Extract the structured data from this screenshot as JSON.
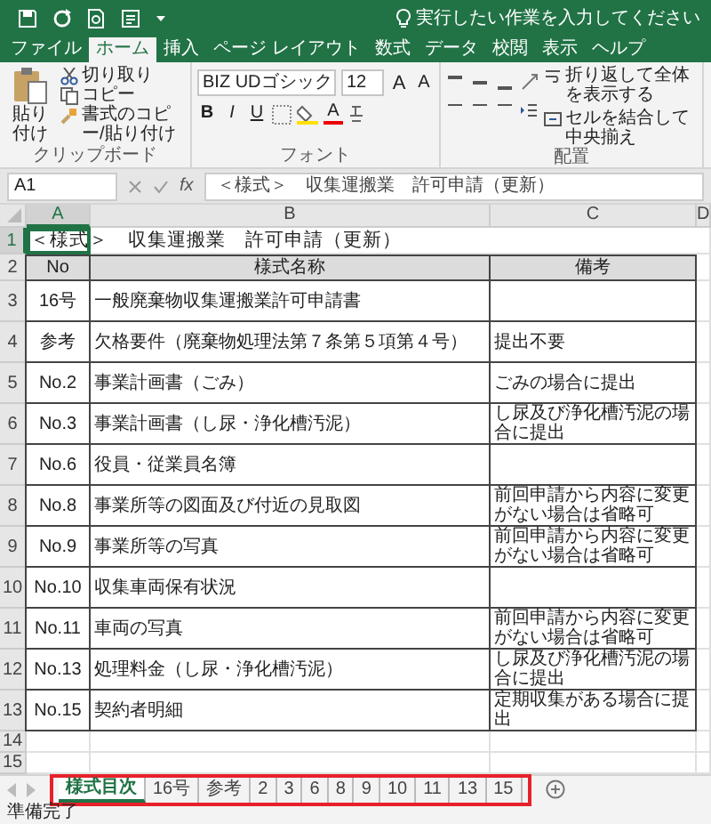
{
  "tell_me": "実行したい作業を入力してください",
  "tabs": [
    {
      "label": "ファイル",
      "selected": false
    },
    {
      "label": "ホーム",
      "selected": true
    },
    {
      "label": "挿入",
      "selected": false
    },
    {
      "label": "ページ レイアウト",
      "selected": false
    },
    {
      "label": "数式",
      "selected": false
    },
    {
      "label": "データ",
      "selected": false
    },
    {
      "label": "校閲",
      "selected": false
    },
    {
      "label": "表示",
      "selected": false
    },
    {
      "label": "ヘルプ",
      "selected": false
    }
  ],
  "clipboard": {
    "paste": "貼り付け",
    "cut": "切り取り",
    "copy": "コピー",
    "format_painter": "書式のコピー/貼り付け",
    "label": "クリップボード"
  },
  "font": {
    "name": "BIZ UDゴシック",
    "size": "12",
    "grow": "A",
    "shrink": "A",
    "bold": "B",
    "italic": "I",
    "underline": "U",
    "color_button": "A",
    "label": "フォント"
  },
  "alignment": {
    "wrap_text": "折り返して全体を表示する",
    "merge_center": "セルを結合して中央揃え",
    "label": "配置"
  },
  "formula_bar": {
    "name_box": "A1",
    "function": "fx",
    "value": "＜様式＞　収集運搬業　許可申請（更新）"
  },
  "columns": [
    {
      "label": "A",
      "selected": true
    },
    {
      "label": "B",
      "selected": false
    },
    {
      "label": "C",
      "selected": false
    },
    {
      "label": "D",
      "selected": false
    }
  ],
  "rows": [
    {
      "number": "1",
      "selected": true,
      "kind": "title",
      "text": "＜様式＞　収集運搬業　許可申請（更新）"
    },
    {
      "number": "2",
      "selected": false,
      "kind": "header",
      "no": "No",
      "name": "様式名称",
      "note": "備考"
    },
    {
      "number": "3",
      "selected": false,
      "kind": "item",
      "no": "16号",
      "name": "一般廃棄物収集運搬業許可申請書"
    },
    {
      "number": "4",
      "selected": false,
      "kind": "item",
      "no": "参考",
      "name": "欠格要件（廃棄物処理法第７条第５項第４号）",
      "note": "提出不要"
    },
    {
      "number": "5",
      "selected": false,
      "kind": "item",
      "no": "No.2",
      "name": "事業計画書（ごみ）",
      "note": "ごみの場合に提出"
    },
    {
      "number": "6",
      "selected": false,
      "kind": "item",
      "no": "No.3",
      "name": "事業計画書（し尿・浄化槽汚泥）",
      "note": "し尿及び浄化槽汚泥の場合に提出"
    },
    {
      "number": "7",
      "selected": false,
      "kind": "item",
      "no": "No.6",
      "name": "役員・従業員名簿"
    },
    {
      "number": "8",
      "selected": false,
      "kind": "item",
      "no": "No.8",
      "name": "事業所等の図面及び付近の見取図",
      "note": "前回申請から内容に変更がない場合は省略可"
    },
    {
      "number": "9",
      "selected": false,
      "kind": "item",
      "no": "No.9",
      "name": "事業所等の写真",
      "note": "前回申請から内容に変更がない場合は省略可"
    },
    {
      "number": "10",
      "selected": false,
      "kind": "item",
      "no": "No.10",
      "name": "収集車両保有状況"
    },
    {
      "number": "11",
      "selected": false,
      "kind": "item",
      "no": "No.11",
      "name": "車両の写真",
      "note": "前回申請から内容に変更がない場合は省略可"
    },
    {
      "number": "12",
      "selected": false,
      "kind": "item",
      "no": "No.13",
      "name": "処理料金（し尿・浄化槽汚泥）",
      "note": "し尿及び浄化槽汚泥の場合に提出"
    },
    {
      "number": "13",
      "selected": false,
      "kind": "item",
      "no": "No.15",
      "name": "契約者明細",
      "note": "定期収集がある場合に提出"
    },
    {
      "number": "14",
      "selected": false,
      "kind": "empty"
    },
    {
      "number": "15",
      "selected": false,
      "kind": "empty"
    }
  ],
  "sheet_tabs": [
    {
      "label": "様式目次",
      "selected": true
    },
    {
      "label": "16号",
      "selected": false
    },
    {
      "label": "参考",
      "selected": false
    },
    {
      "label": "2",
      "selected": false
    },
    {
      "label": "3",
      "selected": false
    },
    {
      "label": "6",
      "selected": false
    },
    {
      "label": "8",
      "selected": false
    },
    {
      "label": "9",
      "selected": false
    },
    {
      "label": "10",
      "selected": false
    },
    {
      "label": "11",
      "selected": false
    },
    {
      "label": "13",
      "selected": false
    },
    {
      "label": "15",
      "selected": false
    }
  ],
  "status": "準備完了"
}
